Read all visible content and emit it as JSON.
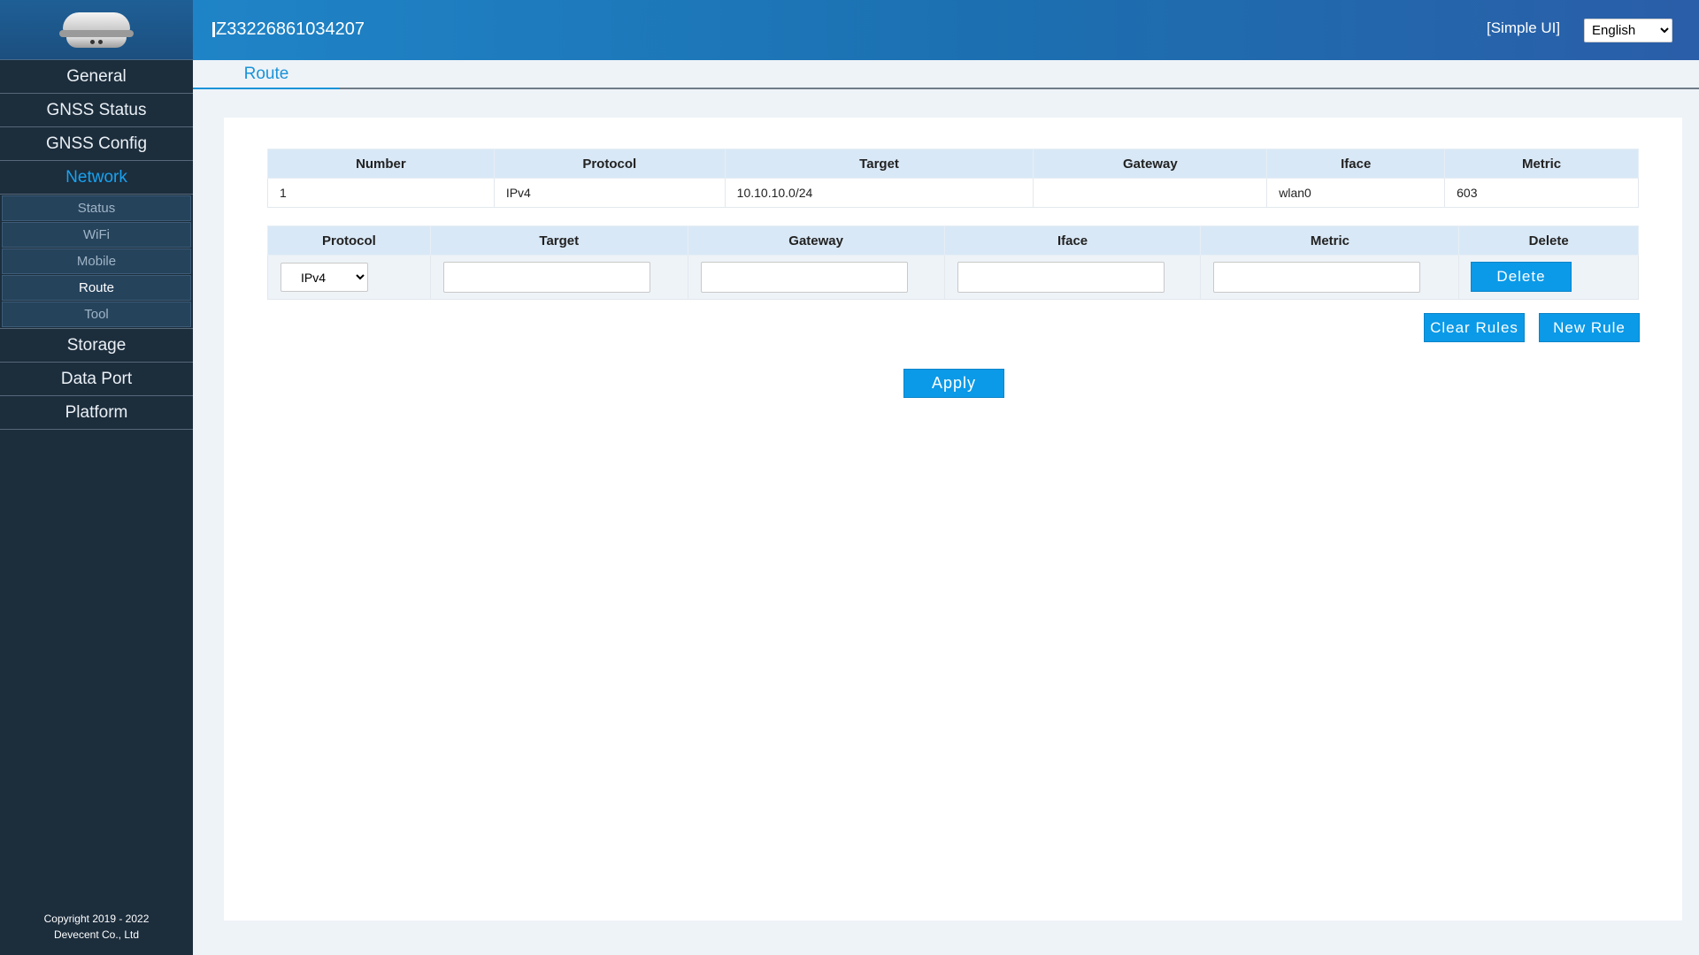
{
  "header": {
    "device_id": "Z33226861034207",
    "simple_ui": "[Simple UI]",
    "language": "English"
  },
  "sidebar": {
    "items": [
      {
        "label": "General"
      },
      {
        "label": "GNSS Status"
      },
      {
        "label": "GNSS Config"
      },
      {
        "label": "Network",
        "active": true
      },
      {
        "label": "Storage"
      },
      {
        "label": "Data Port"
      },
      {
        "label": "Platform"
      }
    ],
    "network_sub": [
      {
        "label": "Status"
      },
      {
        "label": "WiFi"
      },
      {
        "label": "Mobile"
      },
      {
        "label": "Route",
        "active": true
      },
      {
        "label": "Tool"
      }
    ],
    "copyright_line1": "Copyright 2019 - 2022",
    "copyright_line2": "Devecent Co., Ltd"
  },
  "tab": {
    "label": "Route"
  },
  "route_table": {
    "headers": [
      "Number",
      "Protocol",
      "Target",
      "Gateway",
      "Iface",
      "Metric"
    ],
    "rows": [
      [
        "1",
        "IPv4",
        "10.10.10.0/24",
        "",
        "wlan0",
        "603"
      ]
    ]
  },
  "edit_table": {
    "headers": [
      "Protocol",
      "Target",
      "Gateway",
      "Iface",
      "Metric",
      "Delete"
    ],
    "protocol_value": "IPv4",
    "delete_label": "Delete"
  },
  "buttons": {
    "clear_rules": "Clear Rules",
    "new_rule": "New Rule",
    "apply": "Apply"
  },
  "colors": {
    "accent": "#0b9ae8",
    "sidebar_bg": "#1c2d3c",
    "table_header_bg": "#d9e8f6"
  }
}
